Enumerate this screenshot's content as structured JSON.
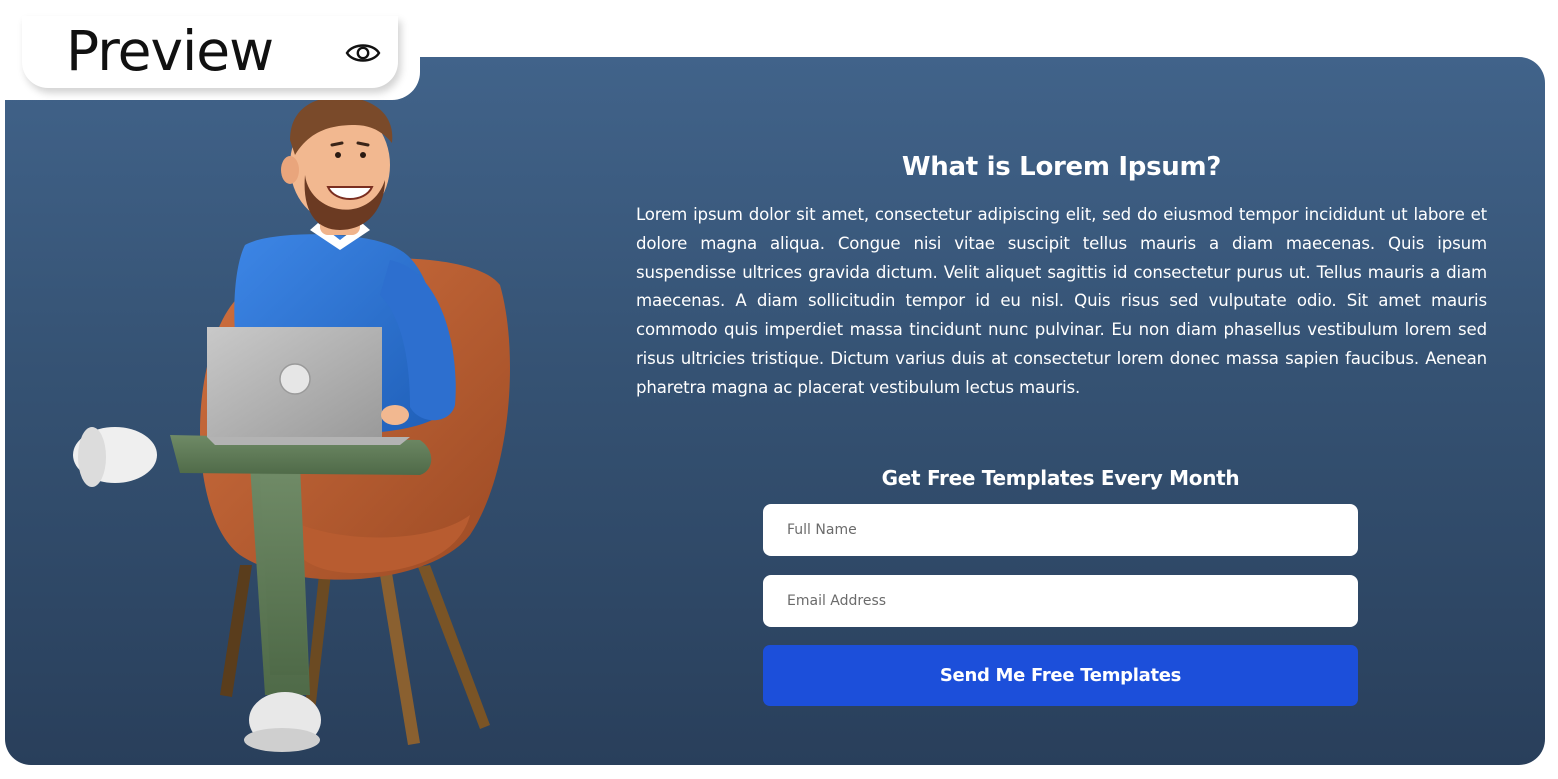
{
  "preview_tab": {
    "label": "Preview",
    "icon": "eye-icon"
  },
  "main": {
    "heading": "What is Lorem Ipsum?",
    "body": "Lorem ipsum dolor sit amet, consectetur adipiscing elit, sed do eiusmod tempor incididunt ut labore et dolore magna aliqua. Congue nisi vitae suscipit tellus mauris a diam maecenas. Quis ipsum suspendisse ultrices gravida dictum. Velit aliquet sagittis id consectetur purus ut. Tellus mauris a diam maecenas. A diam sollicitudin tempor id eu nisl. Quis risus sed vulputate odio. Sit amet mauris commodo quis imperdiet massa tincidunt nunc pulvinar. Eu non diam phasellus vestibulum lorem sed risus ultricies tristique. Dictum varius duis at consectetur lorem donec massa sapien faucibus. Aenean pharetra magna ac placerat vestibulum lectus mauris."
  },
  "signup": {
    "title": "Get Free Templates Every Month",
    "name_placeholder": "Full Name",
    "name_value": "",
    "email_placeholder": "Email Address",
    "email_value": "",
    "submit_label": "Send Me Free Templates"
  },
  "colors": {
    "card_top": "#41638a",
    "card_bottom": "#293f5b",
    "button": "#1c4fda",
    "text": "#ffffff"
  }
}
